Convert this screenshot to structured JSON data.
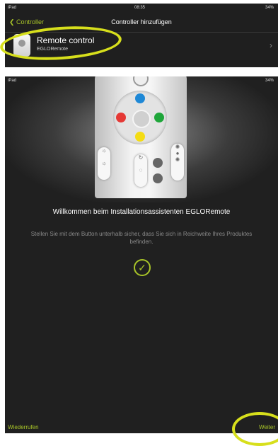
{
  "screen1": {
    "status": {
      "left": "iPad",
      "time": "08:35",
      "right": "34%"
    },
    "nav": {
      "back_label": "Controller",
      "title": "Controller hinzufügen"
    },
    "device": {
      "name": "Remote control",
      "subtitle": "EGLORemote",
      "chevron": "›"
    }
  },
  "screen2": {
    "status": {
      "left": "iPad",
      "right": "34%"
    },
    "welcome": "Willkommen beim Installationsassistenten EGLORemote",
    "hint": "Stellen Sie mit dem Button unterhalb sicher, dass Sie sich in Reichweite Ihres Produktes befinden.",
    "check_glyph": "✓",
    "footer": {
      "undo_label": "Wiederrufen",
      "next_label": "Weiter"
    }
  },
  "colors": {
    "accent": "#a8c428",
    "highlight": "#d7df1c",
    "btn_blue": "#1e88d6",
    "btn_red": "#e53935",
    "btn_green": "#1fa63a",
    "btn_yellow": "#f4dc14"
  }
}
